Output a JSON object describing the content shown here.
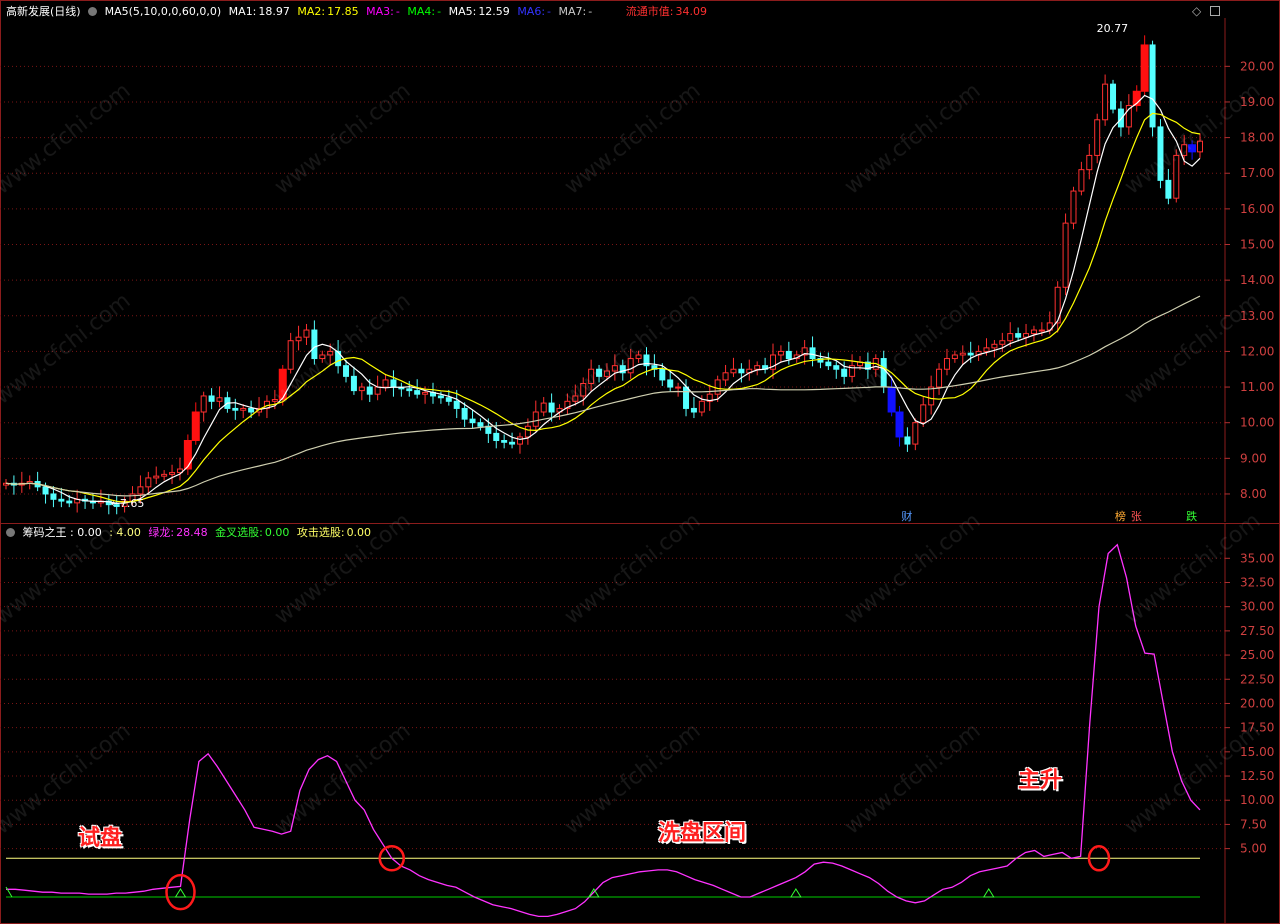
{
  "price_panel": {
    "stock_title": "高新发展(日线)",
    "ma_formula": "MA5(5,10,0,0,60,0,0)",
    "ma1": {
      "label": "MA1:",
      "value": "18.97",
      "color": "#ffffff"
    },
    "ma2": {
      "label": "MA2:",
      "value": "17.85",
      "color": "#ffff00"
    },
    "ma3": {
      "label": "MA3:",
      "value": "-",
      "color": "#ff00ff"
    },
    "ma4": {
      "label": "MA4:",
      "value": "-",
      "color": "#00ff00"
    },
    "ma5": {
      "label": "MA5:",
      "value": "12.59",
      "color": "#ffffff"
    },
    "ma6": {
      "label": "MA6:",
      "value": "-",
      "color": "#3333ff"
    },
    "ma7": {
      "label": "MA7:",
      "value": "-",
      "color": "#cccccc"
    },
    "market_cap_label": "流通市值:",
    "market_cap_value": "34.09",
    "high_label": "20.77",
    "low_label": "←7.65",
    "event_markers": [
      "财",
      "榜",
      "张",
      "跌"
    ],
    "diamond_icon": "diamond-icon",
    "window_icon": "window-icon"
  },
  "indicator_panel": {
    "title": "筹码之王",
    "v1": ": 0.00",
    "v2": ": 4.00",
    "green_dragon_label": "绿龙:",
    "green_dragon_value": "28.48",
    "golden_cross_label": "金叉选股:",
    "golden_cross_value": "0.00",
    "attack_label": "攻击选股:",
    "attack_value": "0.00"
  },
  "annotations": {
    "trial": "试盘",
    "wash": "洗盘区间",
    "main_rise": "主升"
  },
  "watermark": "www.cfchi.com",
  "chart_data": [
    {
      "type": "candlestick",
      "ylim": [
        7.55,
        21.3
      ],
      "y_ticks": [
        "8.00",
        "9.00",
        "10.00",
        "11.00",
        "12.00",
        "13.00",
        "14.00",
        "15.00",
        "16.00",
        "17.00",
        "18.00",
        "19.00",
        "20.00"
      ],
      "closes": [
        8.3,
        8.25,
        8.3,
        8.35,
        8.2,
        8.0,
        7.85,
        7.8,
        7.75,
        7.85,
        7.8,
        7.75,
        7.8,
        7.7,
        7.65,
        7.8,
        8.0,
        8.2,
        8.45,
        8.5,
        8.55,
        8.6,
        8.7,
        9.5,
        10.3,
        10.75,
        10.6,
        10.7,
        10.4,
        10.35,
        10.4,
        10.3,
        10.4,
        10.6,
        10.65,
        11.5,
        12.3,
        12.4,
        12.6,
        11.8,
        11.9,
        12.0,
        11.6,
        11.3,
        10.9,
        11.0,
        10.8,
        11.0,
        11.2,
        11.0,
        10.95,
        10.9,
        10.8,
        10.85,
        10.75,
        10.7,
        10.6,
        10.4,
        10.1,
        10.0,
        9.9,
        9.7,
        9.5,
        9.45,
        9.4,
        9.6,
        9.9,
        10.3,
        10.55,
        10.3,
        10.4,
        10.6,
        10.75,
        11.1,
        11.5,
        11.3,
        11.45,
        11.6,
        11.4,
        11.8,
        11.9,
        11.6,
        11.5,
        11.2,
        11.0,
        11.0,
        10.4,
        10.3,
        10.6,
        10.8,
        11.2,
        11.4,
        11.5,
        11.4,
        11.5,
        11.6,
        11.5,
        11.9,
        12.0,
        11.8,
        11.9,
        12.1,
        11.8,
        11.7,
        11.6,
        11.5,
        11.3,
        11.6,
        11.7,
        11.5,
        11.8,
        11.0,
        10.3,
        9.6,
        9.4,
        10.0,
        10.5,
        11.0,
        11.5,
        11.8,
        11.9,
        11.95,
        11.9,
        12.0,
        12.1,
        12.2,
        12.3,
        12.5,
        12.4,
        12.5,
        12.6,
        12.6,
        12.8,
        13.8,
        15.6,
        16.5,
        17.1,
        17.5,
        18.5,
        19.5,
        18.8,
        18.3,
        18.9,
        19.3,
        20.6,
        18.3,
        16.8,
        16.3,
        17.5,
        17.8,
        17.6,
        17.9
      ],
      "ma_series": [
        {
          "name": "MA1",
          "color": "#ffffff",
          "period": 5
        },
        {
          "name": "MA2",
          "color": "#ffff00",
          "period": 10
        },
        {
          "name": "MA5",
          "color": "#cfcfb0",
          "period": 60
        }
      ]
    },
    {
      "type": "line",
      "ylim": [
        0,
        37.2
      ],
      "y_ticks": [
        "5.00",
        "7.50",
        "10.00",
        "12.50",
        "15.00",
        "17.50",
        "20.00",
        "22.50",
        "25.00",
        "27.50",
        "30.00",
        "32.50",
        "35.00"
      ],
      "threshold_lines": [
        {
          "value": 4.0,
          "color": "#ffff80"
        },
        {
          "value": 0.0,
          "color": "#00cc00"
        }
      ],
      "series": [
        {
          "color": "#ff33ff",
          "values": [
            0.8,
            0.8,
            0.7,
            0.6,
            0.5,
            0.5,
            0.4,
            0.4,
            0.4,
            0.3,
            0.3,
            0.3,
            0.4,
            0.4,
            0.5,
            0.6,
            0.8,
            0.9,
            1.0,
            1.1,
            8.0,
            14.0,
            14.8,
            13.5,
            12.0,
            10.5,
            9.0,
            7.2,
            7.0,
            6.8,
            6.5,
            6.8,
            11.0,
            13.2,
            14.2,
            14.6,
            14.0,
            12.0,
            10.0,
            9.0,
            7.0,
            5.5,
            4.0,
            3.2,
            2.8,
            2.2,
            1.8,
            1.5,
            1.2,
            1.0,
            0.5,
            0.0,
            -0.4,
            -0.8,
            -1.0,
            -1.2,
            -1.5,
            -1.8,
            -2.0,
            -2.0,
            -1.8,
            -1.5,
            -1.2,
            -0.5,
            0.5,
            1.5,
            2.0,
            2.2,
            2.4,
            2.6,
            2.7,
            2.8,
            2.8,
            2.6,
            2.2,
            1.8,
            1.5,
            1.2,
            0.8,
            0.4,
            0.0,
            0.0,
            0.4,
            0.8,
            1.2,
            1.6,
            2.0,
            2.6,
            3.4,
            3.6,
            3.5,
            3.2,
            2.8,
            2.4,
            2.0,
            1.4,
            0.6,
            0.0,
            -0.4,
            -0.6,
            -0.4,
            0.2,
            0.8,
            1.0,
            1.5,
            2.2,
            2.6,
            2.8,
            3.0,
            3.2,
            4.0,
            4.6,
            4.8,
            4.2,
            4.4,
            4.6,
            4.0,
            4.2,
            18.0,
            30.0,
            35.5,
            36.4,
            33.0,
            28.0,
            25.2,
            25.1,
            20.0,
            15.0,
            12.0,
            10.0,
            9.0
          ]
        }
      ]
    }
  ]
}
